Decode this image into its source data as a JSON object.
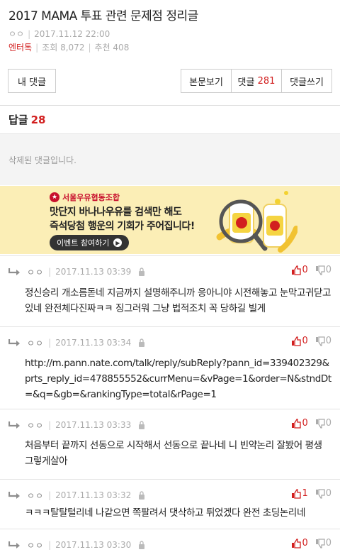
{
  "post": {
    "title": "2017 MAMA 투표 관련 문제점 정리글",
    "author": "ㅇㅇ",
    "date": "2017.11.12 22:00",
    "category": "엔터톡",
    "views_label": "조회",
    "views": "8,072",
    "recommend_label": "추천",
    "recommend": "408"
  },
  "toolbar": {
    "my_comments": "내 댓글",
    "view_body": "본문보기",
    "comments_label": "댓글",
    "comments_count": "281",
    "write_comment": "댓글쓰기"
  },
  "replies": {
    "label": "답글",
    "count": "28",
    "deleted_text": "삭제된 댓글입니다."
  },
  "ad": {
    "brand": "서울우유협동조합",
    "line1": "맛단지 바나나우유를 검색만 해도",
    "line2": "즉석당첨 행운의 기회가 주어집니다!",
    "button": "이벤트 참여하기"
  },
  "comments": [
    {
      "nick": "ㅇㅇ",
      "date": "2017.11.13 03:39",
      "up": "0",
      "down": "0",
      "text": "정신승리 개소름돋네 지금까지 설명해주니까 응아니야 시전해놓고 눈막고귀닫고있네 완전체다진짜ㅋㅋ 징그러워 그냥 법적조치 꼭 당하길 빌게"
    },
    {
      "nick": "ㅇㅇ",
      "date": "2017.11.13 03:34",
      "up": "0",
      "down": "0",
      "text": "http://m.pann.nate.com/talk/reply/subReply?pann_id=339402329&prts_reply_id=478855552&currMenu=&vPage=1&order=N&stndDt=&q=&gb=&rankingType=total&rPage=1"
    },
    {
      "nick": "ㅇㅇ",
      "date": "2017.11.13 03:33",
      "up": "0",
      "down": "0",
      "text": "처음부터 끝까지 선동으로 시작해서 선동으로 끝나네 니 빈약논리 잘봤어 평생 그렇게살아"
    },
    {
      "nick": "ㅇㅇ",
      "date": "2017.11.13 03:32",
      "up": "1",
      "down": "0",
      "text": "ㅋㅋㅋ탈탈털리네 나같으면 쪽팔려서 댓삭하고 튀었겠다 완전 초딩논리네"
    },
    {
      "nick": "ㅇㅇ",
      "date": "2017.11.13 03:30",
      "up": "0",
      "down": "0",
      "text": ""
    }
  ],
  "colors": {
    "accent_red": "#d21f1f",
    "ad_bg": "#fbeeb6"
  }
}
